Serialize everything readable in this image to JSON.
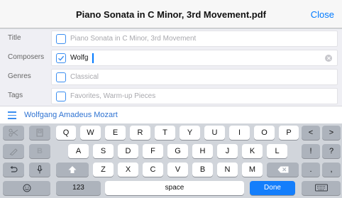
{
  "navbar": {
    "title": "Piano Sonata in C Minor, 3rd Movement.pdf",
    "close_label": "Close"
  },
  "form": {
    "title": {
      "label": "Title",
      "placeholder": "Piano Sonata in C Minor, 3rd Movement",
      "checked": false
    },
    "composers": {
      "label": "Composers",
      "value": "Wolfg",
      "checked": true
    },
    "genres": {
      "label": "Genres",
      "placeholder": "Classical",
      "checked": false
    },
    "tags": {
      "label": "Tags",
      "placeholder": "Favorites, Warm-up Pieces",
      "checked": false
    }
  },
  "suggestion": {
    "text": "Wolfgang Amadeus Mozart",
    "icon": "list-icon"
  },
  "keyboard": {
    "row1": [
      "Q",
      "W",
      "E",
      "R",
      "T",
      "Y",
      "U",
      "I",
      "O",
      "P"
    ],
    "row2": [
      "A",
      "S",
      "D",
      "F",
      "G",
      "H",
      "J",
      "K",
      "L"
    ],
    "row3": [
      "Z",
      "X",
      "C",
      "V",
      "B",
      "N",
      "M"
    ],
    "left_col1": [
      "scissors-icon",
      "paste-icon",
      "undo-icon",
      "emoji-icon"
    ],
    "left_col2": [
      "copy-icon",
      "B",
      "mic-icon",
      "123"
    ],
    "right_row1": [
      "<",
      ">"
    ],
    "right_row2": [
      "!",
      "?"
    ],
    "right_row3": [
      ".",
      ","
    ],
    "space_label": "space",
    "done_label": "Done",
    "keyboard_icon": "keyboard-icon",
    "colors": {
      "accent": "#007aff",
      "done": "#147efb",
      "key": "#ffffff",
      "dark_key": "#adb3bc",
      "background": "#d1d5db"
    }
  }
}
